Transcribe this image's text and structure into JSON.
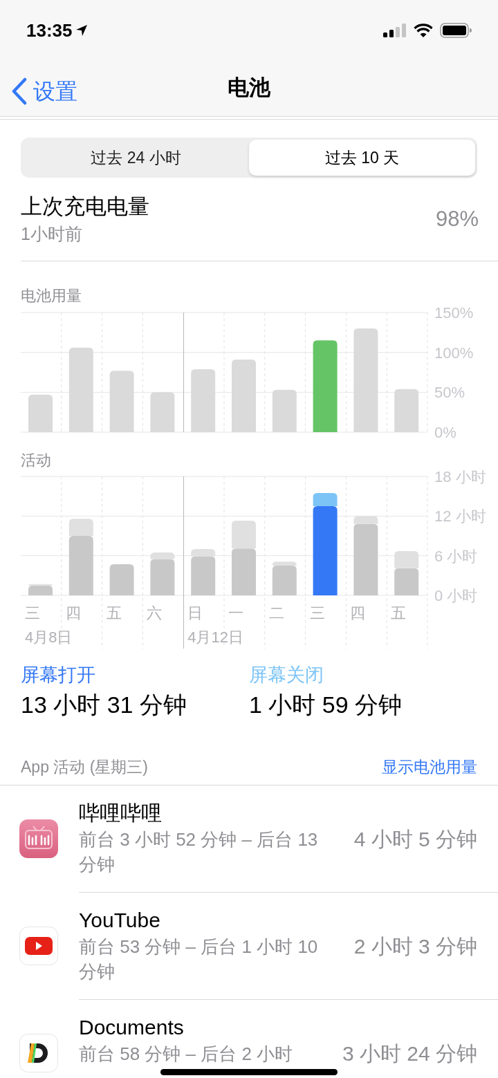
{
  "status_bar": {
    "time": "13:35"
  },
  "nav": {
    "back": "设置",
    "title": "电池"
  },
  "segments": [
    {
      "label": "过去 24 小时",
      "selected": false
    },
    {
      "label": "过去 10 天",
      "selected": true
    }
  ],
  "last_charge": {
    "title": "上次充电电量",
    "time": "1小时前",
    "value": "98%"
  },
  "battery_chart": {
    "title": "电池用量",
    "chart_data": {
      "type": "bar",
      "ylim": [
        0,
        150
      ],
      "yticks": [
        {
          "value": 0,
          "label": "0%"
        },
        {
          "value": 50,
          "label": "50%"
        },
        {
          "value": 100,
          "label": "100%"
        },
        {
          "value": 150,
          "label": "150%"
        }
      ],
      "series": [
        {
          "color": "#dadada",
          "values": [
            47,
            106,
            77,
            50,
            79,
            91,
            53,
            null,
            130,
            54
          ]
        },
        {
          "color": "#65c466",
          "values": [
            null,
            null,
            null,
            null,
            null,
            null,
            null,
            115,
            null,
            null
          ]
        }
      ]
    }
  },
  "activity_chart": {
    "title": "活动",
    "chart_data": {
      "type": "bar",
      "stacked": true,
      "ylim": [
        0,
        18
      ],
      "yticks": [
        {
          "value": 0,
          "label": "0 小时"
        },
        {
          "value": 6,
          "label": "6 小时"
        },
        {
          "value": 12,
          "label": "12 小时"
        },
        {
          "value": 18,
          "label": "18 小时"
        }
      ],
      "series": [
        {
          "color": "#c8c8c8",
          "values": [
            1.5,
            9.0,
            4.7,
            5.5,
            5.9,
            7.1,
            4.5,
            null,
            10.8,
            4.1
          ]
        },
        {
          "color": "#e0e0e0",
          "values": [
            0.2,
            2.6,
            0,
            1.0,
            1.1,
            4.2,
            0.6,
            null,
            1.2,
            2.6
          ]
        },
        {
          "color": "#3478f6",
          "values": [
            null,
            null,
            null,
            null,
            null,
            null,
            null,
            13.5,
            null,
            null
          ]
        },
        {
          "color": "#7cc4f6",
          "values": [
            null,
            null,
            null,
            null,
            null,
            null,
            null,
            2.0,
            null,
            null
          ]
        }
      ]
    },
    "weeks": [
      {
        "date": "4月8日",
        "days": [
          "三",
          "四",
          "五",
          "六"
        ]
      },
      {
        "date": "4月12日",
        "days": [
          "日",
          "一",
          "二",
          "三",
          "四",
          "五"
        ]
      }
    ]
  },
  "screen_time": [
    {
      "label": "屏幕打开",
      "value": "13 小时 31 分钟",
      "color": "#3478f6"
    },
    {
      "label": "屏幕关闭",
      "value": "1 小时 59 分钟",
      "color": "#7cc4f6"
    }
  ],
  "app_activity": {
    "header": "App 活动 (星期三)",
    "link": "显示电池用量",
    "apps": [
      {
        "kind": "bilibili",
        "name": "哔哩哔哩",
        "detail": "前台 3 小时 52 分钟 – 后台 13 分钟",
        "total": "4 小时 5 分钟"
      },
      {
        "kind": "youtube",
        "name": "YouTube",
        "detail": "前台 53 分钟 – 后台 1 小时 10 分钟",
        "total": "2 小时 3 分钟"
      },
      {
        "kind": "documents",
        "name": "Documents",
        "detail": "前台 58 分钟 – 后台 2 小时",
        "total": "3 小时 24 分钟"
      }
    ]
  }
}
